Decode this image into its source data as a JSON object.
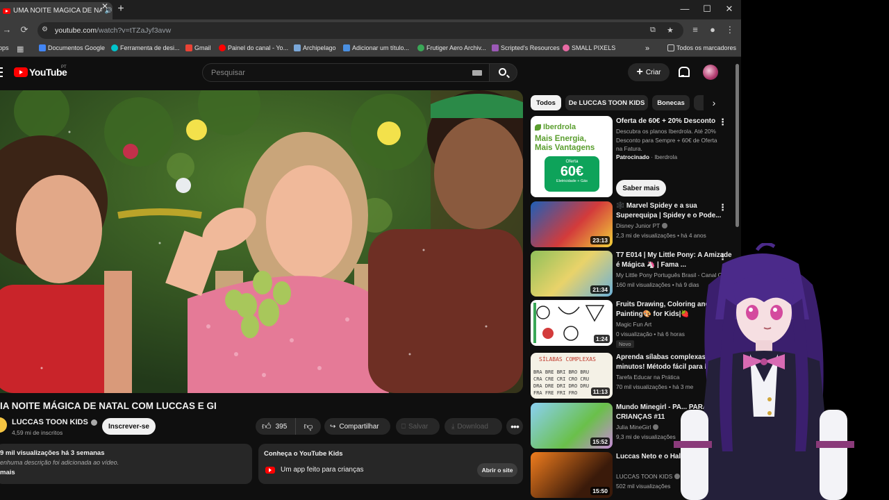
{
  "browser": {
    "tab_title": "UMA NOITE MÁGICA DE NATAL",
    "tab_close": "✕",
    "new_tab": "+",
    "window_controls": {
      "minimize": "—",
      "maximize": "☐",
      "close": "✕"
    },
    "url_host": "youtube.com",
    "url_path": "/watch?v=tTZaJyf3avw",
    "bookmarks": [
      {
        "label": "pps",
        "icon": "apps-icon",
        "color": "#4285f4"
      },
      {
        "label": "",
        "icon": "grid-icon",
        "color": "#cccccc"
      },
      {
        "label": "Documentos Google",
        "icon": "docs-icon",
        "color": "#4285f4"
      },
      {
        "label": "Ferramenta de desi...",
        "icon": "canva-icon",
        "color": "#00c4cc"
      },
      {
        "label": "Gmail",
        "icon": "gmail-icon",
        "color": "#ea4335"
      },
      {
        "label": "Painel do canal - Yo...",
        "icon": "youtube-studio-icon",
        "color": "#ff0000"
      },
      {
        "label": "Archipelago",
        "icon": "archipelago-icon",
        "color": "#7aa7d8"
      },
      {
        "label": "Adicionar um título...",
        "icon": "add-icon",
        "color": "#4a90e2"
      },
      {
        "label": "Frutiger Aero Archiv...",
        "icon": "frutiger-icon",
        "color": "#3aa757"
      },
      {
        "label": "Scripted's Resources",
        "icon": "scripted-icon",
        "color": "#9b59b6"
      },
      {
        "label": "SMALL PIXELS",
        "icon": "pixels-icon",
        "color": "#e86aa4"
      }
    ],
    "bookmarks_overflow": "»",
    "all_bookmarks": "Todos os marcadores"
  },
  "youtube": {
    "logo_text": "YouTube",
    "region": "PT",
    "search_placeholder": "Pesquisar",
    "create_label": "Criar"
  },
  "video": {
    "title": "IA NOITE MÁGICA DE NATAL COM LUCCAS E GI",
    "channel": "LUCCAS TOON KIDS",
    "subscribers": "4,59 mi de inscritos",
    "subscribe_label": "Inscrever-se",
    "likes": "395",
    "share_label": "Compartilhar",
    "save_label": "Salvar",
    "download_label": "Download",
    "more_label": "•••",
    "stats": "9 mil visualizações  há 3 semanas",
    "description": "enhuma descrição foi adicionada ao vídeo.",
    "more": "mais",
    "kids_title": "Conheça o YouTube Kids",
    "kids_text": "Um app feito para crianças",
    "kids_button": "Abrir o site"
  },
  "sidebar": {
    "chips": [
      "Todos",
      "De LUCCAS TOON KIDS",
      "Bonecas"
    ],
    "chip_arrow": "›",
    "ad": {
      "brand": "Iberdrola",
      "headline_1": "Mais Energia,",
      "headline_2": "Mais Vantagens",
      "badge_top": "Oferta",
      "badge_value": "60€",
      "badge_bottom": "Eletricidade + Gás",
      "title": "Oferta de 60€ + 20% Desconto",
      "description": "Descubra os planos Iberdrola. Até 20% Desconto para Sempre + 60€ de Oferta na Fatura.",
      "sponsored": "Patrocinado",
      "advertiser": "· Iberdrola",
      "cta": "Saber mais"
    },
    "recommendations": [
      {
        "title": "🕸️ Marvel Spidey e a sua Superequipa | Spidey e o Pode...",
        "channel": "Disney Junior PT",
        "verified": true,
        "meta": "2,3 mi de visualizações • há 4 anos",
        "duration": "23:13",
        "badge": ""
      },
      {
        "title": "T7 E014 | My Little Pony: A Amizade é Mágica 🦄 | Fama ...",
        "channel": "My Little Pony Português Brasil - Canal O",
        "verified": false,
        "meta": "160 mil visualizações • há 9 dias",
        "duration": "21:34",
        "badge": ""
      },
      {
        "title": "Fruits Drawing, Coloring and Painting🎨 for Kids|🍓",
        "channel": "Magic Fun Art",
        "verified": false,
        "meta": "0 visualização • há 6 horas",
        "duration": "1:24",
        "badge": "Novo"
      },
      {
        "title": "Aprenda sílabas complexas em minutos! Método fácil para le",
        "channel": "Tarefa Educar na Prática",
        "verified": false,
        "meta": "70 mil visualizações • há 3 me",
        "duration": "11:13",
        "badge": ""
      },
      {
        "title": "Mundo Minegirl - PA... PARA CRIANÇAS #11",
        "channel": "Julia MineGirl",
        "verified": true,
        "meta": "9,3 mi de visualizações",
        "duration": "15:52",
        "badge": ""
      },
      {
        "title": "Luccas Neto e o Hallo... crianças 🎃",
        "channel": "LUCCAS TOON KIDS",
        "verified": true,
        "meta": "502 mil visualizações",
        "duration": "15:50",
        "badge": ""
      }
    ]
  }
}
